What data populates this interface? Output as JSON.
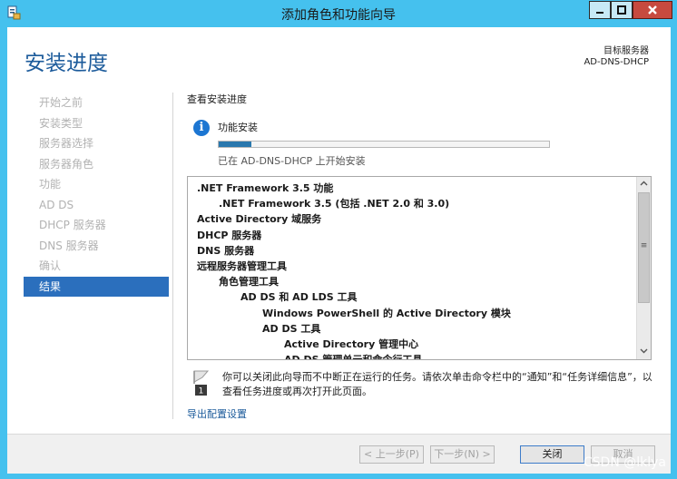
{
  "window": {
    "title": "添加角色和功能向导"
  },
  "header": {
    "page_title": "安装进度",
    "target_server_label": "目标服务器",
    "target_server_name": "AD-DNS-DHCP"
  },
  "nav": {
    "items": [
      {
        "label": "开始之前"
      },
      {
        "label": "安装类型"
      },
      {
        "label": "服务器选择"
      },
      {
        "label": "服务器角色"
      },
      {
        "label": "功能"
      },
      {
        "label": "AD DS"
      },
      {
        "label": "DHCP 服务器"
      },
      {
        "label": "DNS 服务器"
      },
      {
        "label": "确认"
      },
      {
        "label": "结果"
      }
    ],
    "active_index": 9
  },
  "main": {
    "section_title": "查看安装进度",
    "feature_install_label": "功能安装",
    "progress_fraction": 0.1,
    "progress_status": "已在 AD-DNS-DHCP 上开始安装",
    "list": [
      {
        "text": ".NET Framework 3.5 功能",
        "indent": 0
      },
      {
        "text": ".NET Framework 3.5 (包括 .NET 2.0 和 3.0)",
        "indent": 1
      },
      {
        "text": "Active Directory 域服务",
        "indent": 0
      },
      {
        "text": "DHCP 服务器",
        "indent": 0
      },
      {
        "text": "DNS 服务器",
        "indent": 0
      },
      {
        "text": "远程服务器管理工具",
        "indent": 0
      },
      {
        "text": "角色管理工具",
        "indent": 1
      },
      {
        "text": "AD DS 和 AD LDS 工具",
        "indent": 2
      },
      {
        "text": "Windows PowerShell 的 Active Directory 模块",
        "indent": 3
      },
      {
        "text": "AD DS 工具",
        "indent": 3
      },
      {
        "text": "Active Directory 管理中心",
        "indent": 4
      },
      {
        "text": "AD DS 管理单元和命令行工具",
        "indent": 4
      }
    ],
    "note_text": "你可以关闭此向导而不中断正在运行的任务。请依次单击命令栏中的“通知”和“任务详细信息”，以查看任务进度或再次打开此页面。",
    "export_link": "导出配置设置"
  },
  "footer": {
    "prev_label": "< 上一步(P)",
    "next_label": "下一步(N) >",
    "close_label": "关闭",
    "cancel_label": "取消"
  },
  "watermark": "CSDN @lklya"
}
